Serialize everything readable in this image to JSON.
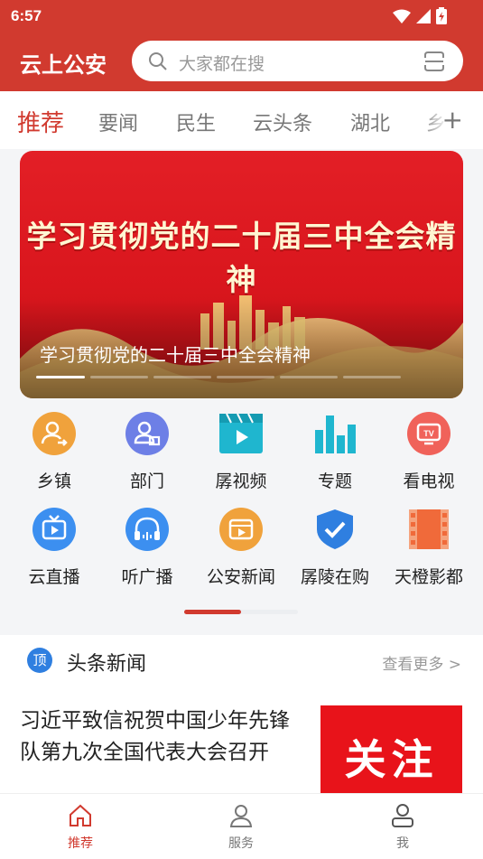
{
  "status": {
    "time": "6:57"
  },
  "header": {
    "app_title": "云上公安",
    "search_placeholder": "大家都在搜"
  },
  "tabs": [
    {
      "label": "推荐",
      "active": true
    },
    {
      "label": "要闻"
    },
    {
      "label": "民生"
    },
    {
      "label": "云头条"
    },
    {
      "label": "湖北"
    },
    {
      "label": "乡"
    }
  ],
  "banner": {
    "headline": "学习贯彻党的二十届三中全会精神",
    "caption": "学习贯彻党的二十届三中全会精神"
  },
  "grid": [
    {
      "label": "乡镇",
      "icon": "town-icon",
      "color": "#f0a23c"
    },
    {
      "label": "部门",
      "icon": "department-icon",
      "color": "#6d7fe6"
    },
    {
      "label": "孱视频",
      "icon": "video-icon",
      "color": "#1fb6cf"
    },
    {
      "label": "专题",
      "icon": "topic-icon",
      "color": "#1fb6cf"
    },
    {
      "label": "看电视",
      "icon": "tv-icon",
      "color": "#f0625a"
    },
    {
      "label": "云直播",
      "icon": "live-icon",
      "color": "#3c8ff0"
    },
    {
      "label": "听广播",
      "icon": "radio-icon",
      "color": "#3c8ff0"
    },
    {
      "label": "公安新闻",
      "icon": "news-icon",
      "color": "#f0a23c"
    },
    {
      "label": "孱陵在购",
      "icon": "shop-icon",
      "color": "#2f7fe0"
    },
    {
      "label": "天橙影都",
      "icon": "film-icon",
      "color": "#f06a3a"
    }
  ],
  "news": {
    "badge": "顶",
    "section_title": "头条新闻",
    "more_label": "查看更多 >",
    "article_title": "习近平致信祝贺中国少年先锋队第九次全国代表大会召开",
    "thumb_text": "关注"
  },
  "bottom_nav": [
    {
      "label": "推荐",
      "active": true
    },
    {
      "label": "服务"
    },
    {
      "label": "我"
    }
  ],
  "colors": {
    "brand": "#d13a2f"
  }
}
